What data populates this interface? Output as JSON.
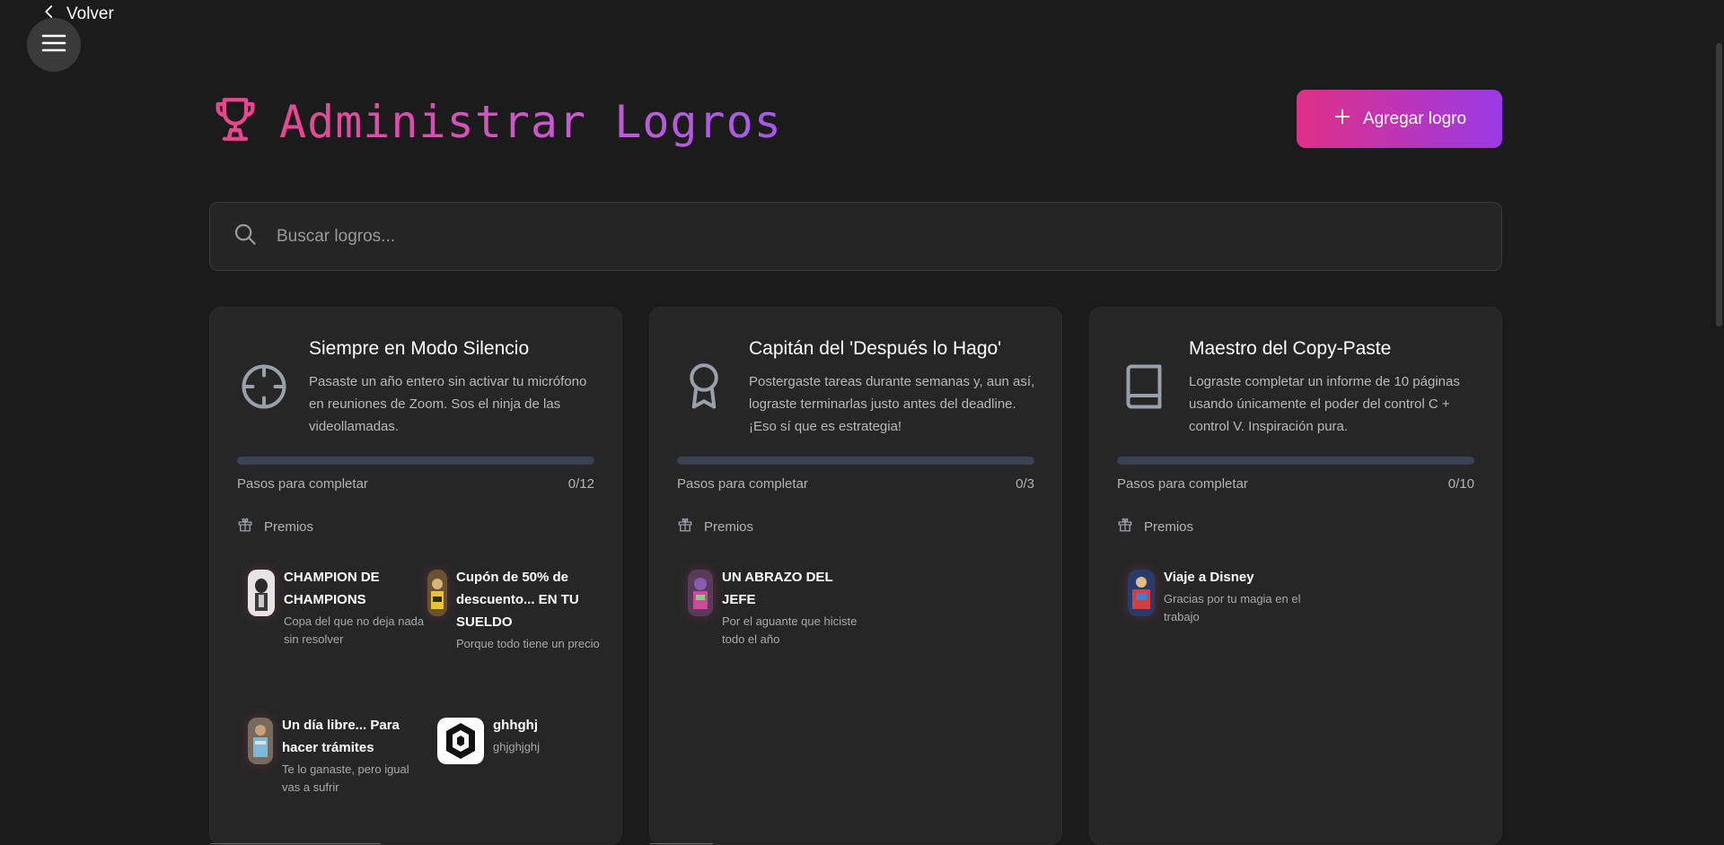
{
  "nav": {
    "back_label": "Volver"
  },
  "header": {
    "title": "Administrar Logros",
    "add_button_label": "Agregar logro"
  },
  "search": {
    "placeholder": "Buscar logros..."
  },
  "colors": {
    "accent_pink": "#e02f86",
    "accent_purple": "#9a3ae6",
    "background": "#1b1b1b",
    "card": "#262626",
    "progress_track": "#3b4254"
  },
  "cards": [
    {
      "icon": "crosshair-icon",
      "title": "Siempre en Modo Silencio",
      "description": "Pasaste un año entero sin activar tu micrófono en reuniones de Zoom. Sos el ninja de las videollamadas.",
      "steps_label": "Pasos para completar",
      "steps": "0/12",
      "progress": 0,
      "prizes_label": "Premios",
      "rewards": [
        {
          "name": "CHAMPION DE CHAMPIONS",
          "description": "Copa del que no deja nada sin resolver"
        },
        {
          "name": "Cupón de 50% de descuento... EN TU SUELDO",
          "description": "Porque todo tiene un precio"
        },
        {
          "name": "Un día libre... Para hacer trámites",
          "description": "Te lo ganaste, pero igual vas a sufrir"
        },
        {
          "name": "ghhghj",
          "description": "ghjghjghj"
        }
      ]
    },
    {
      "icon": "award-ribbon-icon",
      "title": "Capitán del 'Después lo Hago'",
      "description": "Postergaste tareas durante semanas y, aun así, lograste terminarlas justo antes del deadline. ¡Eso sí que es estrategia!",
      "steps_label": "Pasos para completar",
      "steps": "0/3",
      "progress": 0,
      "prizes_label": "Premios",
      "rewards": [
        {
          "name": "UN ABRAZO DEL JEFE",
          "description": "Por el aguante que hiciste todo el año"
        }
      ]
    },
    {
      "icon": "book-icon",
      "title": "Maestro del Copy-Paste",
      "description": "Lograste completar un informe de 10 páginas usando únicamente el poder del control C + control V. Inspiración pura.",
      "steps_label": "Pasos para completar",
      "steps": "0/10",
      "progress": 0,
      "prizes_label": "Premios",
      "rewards": [
        {
          "name": "Viaje a Disney",
          "description": "Gracias por tu magia en el trabajo"
        }
      ]
    }
  ]
}
